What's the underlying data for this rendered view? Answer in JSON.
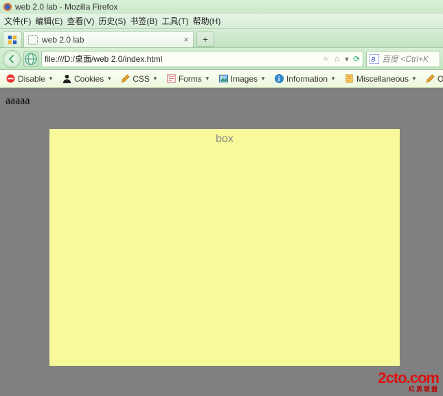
{
  "window": {
    "title": "web 2.0 lab - Mozilla Firefox"
  },
  "menus": {
    "file": "文件(F)",
    "edit": "编辑(E)",
    "view": "查看(V)",
    "history": "历史(S)",
    "bookmarks": "书签(B)",
    "tools": "工具(T)",
    "help": "帮助(H)"
  },
  "tabs": {
    "active": {
      "label": "web 2.0 lab"
    },
    "newtab_label": "+"
  },
  "urlbar": {
    "value": "file:///D:/桌面/web 2.0/index.html"
  },
  "searchbox": {
    "placeholder": "百度 <Ctrl+K"
  },
  "devtoolbar": {
    "disable": "Disable",
    "cookies": "Cookies",
    "css": "CSS",
    "forms": "Forms",
    "images": "Images",
    "information": "Information",
    "miscellaneous": "Miscellaneous",
    "outline": "Outline"
  },
  "page": {
    "text": "aaaaa",
    "box_label": "box"
  },
  "watermark": {
    "brand": "2cto",
    "tld": ".com",
    "sub": "红黑联盟"
  }
}
